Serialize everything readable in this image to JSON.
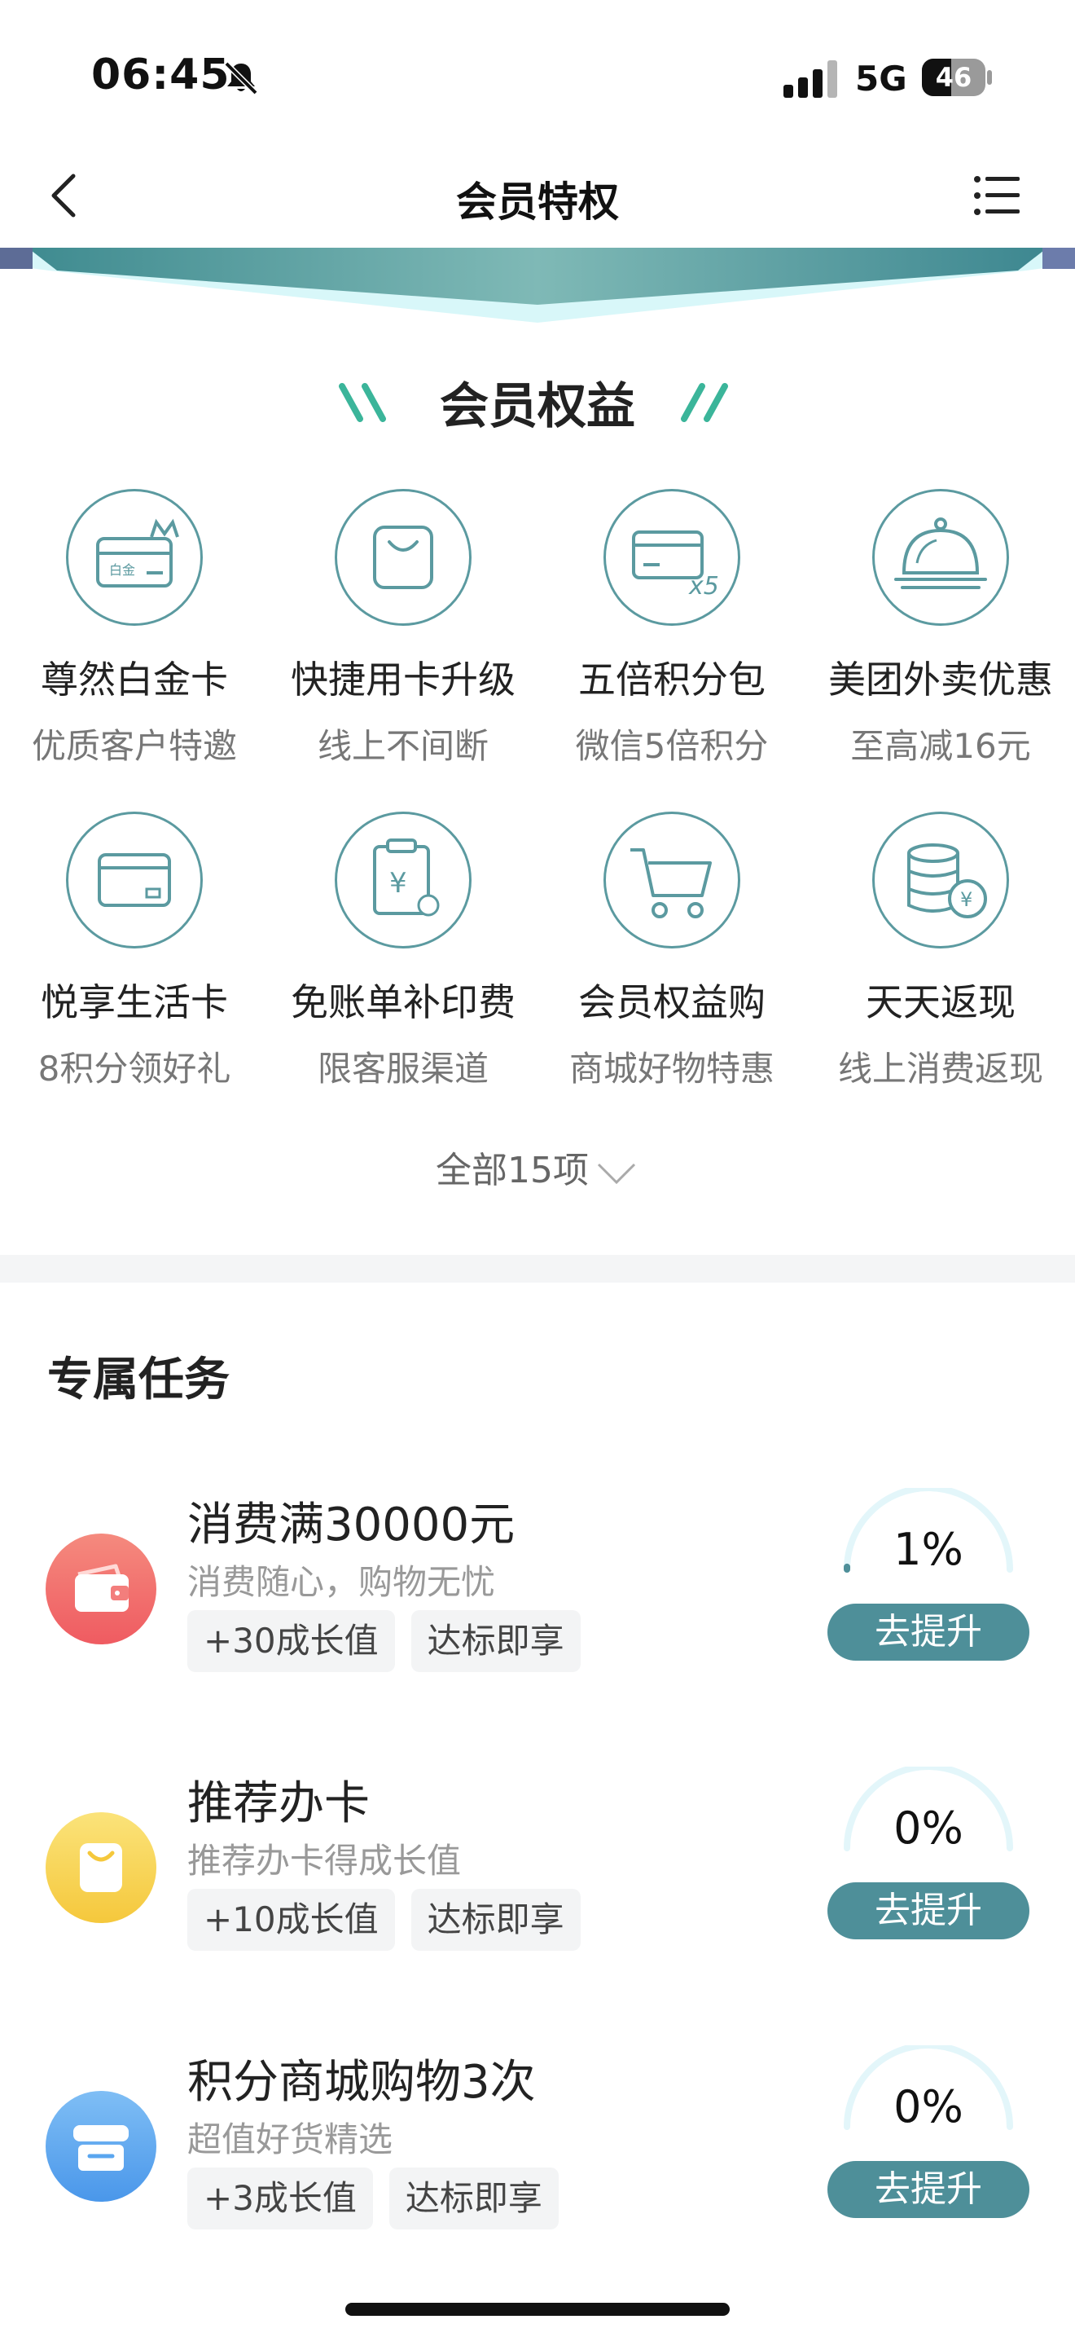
{
  "status_bar": {
    "time": "06:45",
    "network": "5G",
    "battery": "46",
    "battery_level": 0.46
  },
  "nav": {
    "title": "会员特权",
    "back_icon": "chevron-left-icon",
    "menu_icon": "list-icon"
  },
  "benefits": {
    "title": "会员权益",
    "items": [
      {
        "title": "尊然白金卡",
        "subtitle": "优质客户特邀",
        "icon": "platinum-card-icon",
        "icon_text": "白金"
      },
      {
        "title": "快捷用卡升级",
        "subtitle": "线上不间断",
        "icon": "shopping-bag-icon"
      },
      {
        "title": "五倍积分包",
        "subtitle": "微信5倍积分",
        "icon": "card-x5-icon",
        "icon_text": "x5"
      },
      {
        "title": "美团外卖优惠",
        "subtitle": "至高减16元",
        "icon": "food-cloche-icon"
      },
      {
        "title": "悦享生活卡",
        "subtitle": "8积分领好礼",
        "icon": "card-icon"
      },
      {
        "title": "免账单补印费",
        "subtitle": "限客服渠道",
        "icon": "bill-clipboard-icon",
        "icon_text": "¥"
      },
      {
        "title": "会员权益购",
        "subtitle": "商城好物特惠",
        "icon": "shopping-cart-icon"
      },
      {
        "title": "天天返现",
        "subtitle": "线上消费返现",
        "icon": "coins-stack-icon",
        "icon_text": "¥"
      }
    ],
    "show_all": "全部15项"
  },
  "tasks": {
    "title": "专属任务",
    "items": [
      {
        "title": "消费满30000元",
        "desc": "消费随心，购物无忧",
        "tags": [
          "+30成长值",
          "达标即享"
        ],
        "progress": "1%",
        "progress_value": 0.01,
        "button": "去提升",
        "icon": "wallet-icon",
        "color": "#f26a6a"
      },
      {
        "title": "推荐办卡",
        "desc": "推荐办卡得成长值",
        "tags": [
          "+10成长值",
          "达标即享"
        ],
        "progress": "0%",
        "progress_value": 0.0,
        "button": "去提升",
        "icon": "bag-icon",
        "color": "#f7d04a"
      },
      {
        "title": "积分商城购物3次",
        "desc": "超值好货精选",
        "tags": [
          "+3成长值",
          "达标即享"
        ],
        "progress": "0%",
        "progress_value": 0.0,
        "button": "去提升",
        "icon": "store-icon",
        "color": "#5aa6ef"
      }
    ]
  },
  "colors": {
    "accent": "#4e8f99",
    "icon_stroke": "#5b9aa0",
    "teal_deco": "#3bb59a"
  }
}
